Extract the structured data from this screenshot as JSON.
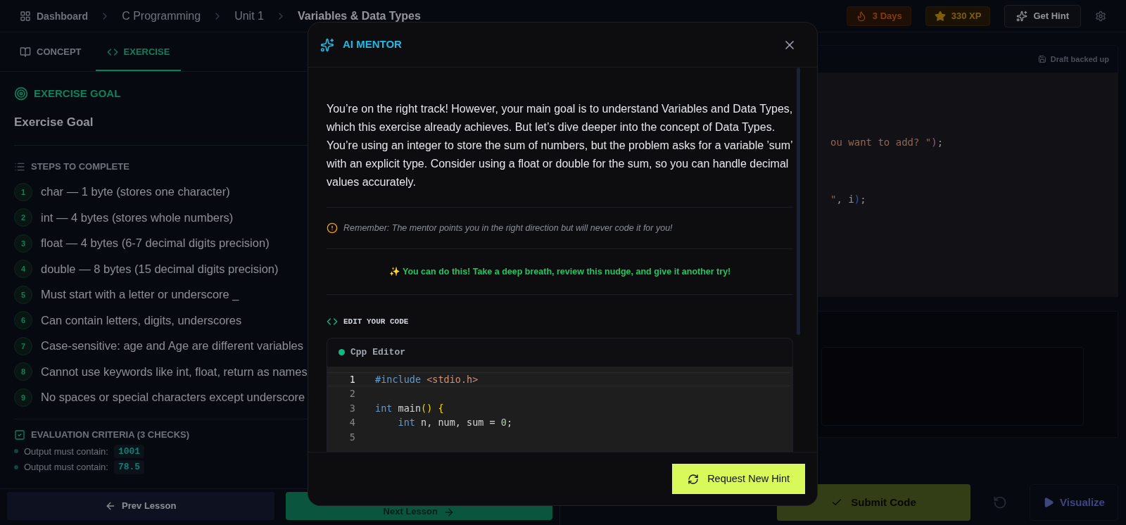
{
  "breadcrumb": [
    {
      "label": "Dashboard",
      "kind": "home"
    },
    {
      "label": "C Programming",
      "kind": "link"
    },
    {
      "label": "Unit 1",
      "kind": "link"
    },
    {
      "label": "Variables & Data Types",
      "kind": "current"
    }
  ],
  "stats": [
    {
      "label": "3 Days",
      "kind": "streak"
    },
    {
      "label": "330 XP",
      "kind": "xp"
    }
  ],
  "hint_button": "Get Hint",
  "tabs": [
    {
      "label": "CONCEPT",
      "kind": "book",
      "selected": false
    },
    {
      "label": "EXERCISE",
      "kind": "code",
      "selected": true
    }
  ],
  "goal": {
    "heading": "EXERCISE GOAL",
    "title": "Exercise Goal"
  },
  "steps": {
    "heading": "STEPS TO COMPLETE",
    "items": [
      {
        "number": "1",
        "text": "char — 1 byte (stores one character)"
      },
      {
        "number": "2",
        "text": "int — 4 bytes (stores whole numbers)"
      },
      {
        "number": "3",
        "text": "float — 4 bytes (6-7 decimal digits precision)"
      },
      {
        "number": "4",
        "text": "double — 8 bytes (15 decimal digits precision)"
      },
      {
        "number": "5",
        "text": "Must start with a letter or underscore _"
      },
      {
        "number": "6",
        "text": "Can contain letters, digits, underscores"
      },
      {
        "number": "7",
        "text": "Case-sensitive: age and Age are different variables"
      },
      {
        "number": "8",
        "text": "Cannot use keywords like int, float, return as names"
      },
      {
        "number": "9",
        "text": "No spaces or special characters except underscore"
      }
    ]
  },
  "criteria": {
    "heading": "EVALUATION CRITERIA (3 CHECKS)",
    "items": [
      {
        "label": "Output must contain:",
        "value": "1001"
      },
      {
        "label": "Output must contain:",
        "value": "78.5"
      }
    ]
  },
  "nav": {
    "prev": "Prev Lesson",
    "next": "Next Lesson"
  },
  "editor": {
    "status": "Draft backed up",
    "lines": [
      [
        {
          "text": "ou want to add? \"",
          "kind": "string"
        },
        {
          "text": ")",
          "kind": "paren"
        },
        {
          "text": ";",
          "kind": "plain"
        }
      ],
      [
        {
          "text": "\"",
          "kind": "string"
        },
        {
          "text": ", i",
          "kind": "plain"
        },
        {
          "text": ")",
          "kind": "bracket"
        },
        {
          "text": ";",
          "kind": "plain"
        }
      ]
    ]
  },
  "actions": {
    "submit": "Submit Code",
    "visualize": "Visualize"
  },
  "modal": {
    "title": "AI MENTOR",
    "message": "You’re on the right track! However, your main goal is to understand Variables and Data Types, which this exercise already achieves. But let’s dive deeper into the concept of Data Types. You’re using an integer to store the sum of numbers, but the problem asks for a variable ’sum’ with an explicit type. Consider using a float or double for the sum, so you can handle decimal values accurately.",
    "reminder": "Remember: The mentor points you in the right direction but will never code it for you!",
    "encouragement": "✨ You can do this! Take a deep breath, review this nudge, and give it another try!",
    "edit_heading": "EDIT YOUR CODE",
    "editor_title": "Cpp Editor",
    "code": [
      {
        "number": "1",
        "active": true,
        "tokens": [
          {
            "text": "#include",
            "kind": "keyword"
          },
          {
            "text": " <stdio.h>",
            "kind": "include"
          }
        ]
      },
      {
        "number": "2",
        "active": false
      },
      {
        "number": "3",
        "active": false,
        "tokens": [
          {
            "text": "int",
            "kind": "keyword"
          },
          {
            "text": " main",
            "kind": "plain"
          },
          {
            "text": "()",
            "kind": "paren-y"
          },
          {
            "text": " {",
            "kind": "paren-y"
          }
        ]
      },
      {
        "number": "4",
        "active": false,
        "tokens": [
          {
            "text": "    int",
            "kind": "keyword"
          },
          {
            "text": " n, num, sum = ",
            "kind": "plain"
          },
          {
            "text": "0",
            "kind": "number"
          },
          {
            "text": ";",
            "kind": "plain"
          }
        ]
      },
      {
        "number": "5",
        "active": false
      }
    ],
    "request_button": "Request New Hint"
  }
}
